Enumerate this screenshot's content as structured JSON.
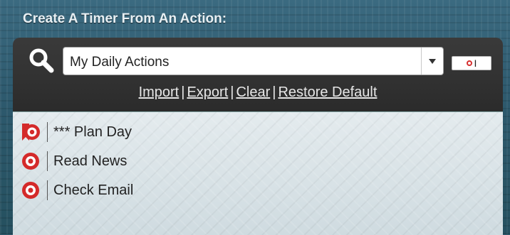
{
  "header": {
    "title": "Create A Timer From An Action:"
  },
  "toolbar": {
    "search_icon": "search-icon",
    "combo": {
      "value": "My Daily Actions"
    },
    "add_button_icon": "timer-add-icon",
    "links": {
      "import": "Import",
      "export": "Export",
      "clear": "Clear",
      "restore_default": "Restore Default",
      "separator": "|"
    }
  },
  "actions": {
    "items": [
      {
        "label": "*** Plan Day",
        "icon": "flagged-target-icon"
      },
      {
        "label": "Read News",
        "icon": "target-icon"
      },
      {
        "label": "Check Email",
        "icon": "target-icon"
      }
    ]
  },
  "colors": {
    "accent_red": "#d63030",
    "toolbar_bg": "#2f2f2f",
    "background": "#2f5a6e"
  }
}
